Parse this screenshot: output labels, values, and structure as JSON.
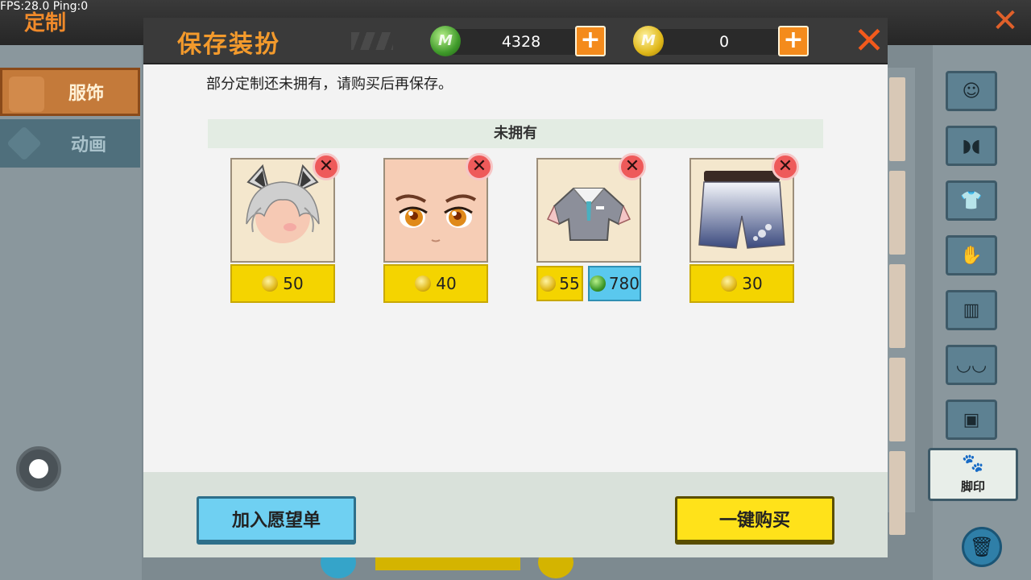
{
  "debug": {
    "fps_ping": "FPS:28.0  Ping:0"
  },
  "background": {
    "title": "定制",
    "tabs": [
      {
        "label": "服饰"
      },
      {
        "label": "动画"
      }
    ],
    "footprint_label": "脚印"
  },
  "dialog": {
    "title": "保存装扮",
    "currency": {
      "gems": "4328",
      "coins": "0"
    },
    "notice": "部分定制还未拥有，请购买后再保存。",
    "section_title": "未拥有",
    "items": [
      {
        "name": "hair-cat-ears",
        "coin_price": "50"
      },
      {
        "name": "face-eyes",
        "coin_price": "40"
      },
      {
        "name": "shirt",
        "coin_price": "55",
        "gem_price": "780"
      },
      {
        "name": "pants",
        "coin_price": "30"
      }
    ],
    "buttons": {
      "wishlist": "加入愿望单",
      "buy_all": "一键购买"
    }
  },
  "colors": {
    "title_orange": "#f39a2c",
    "price_yellow": "#f4d400",
    "gem_blue": "#5ac8ee",
    "close_red": "#f25a1c"
  }
}
